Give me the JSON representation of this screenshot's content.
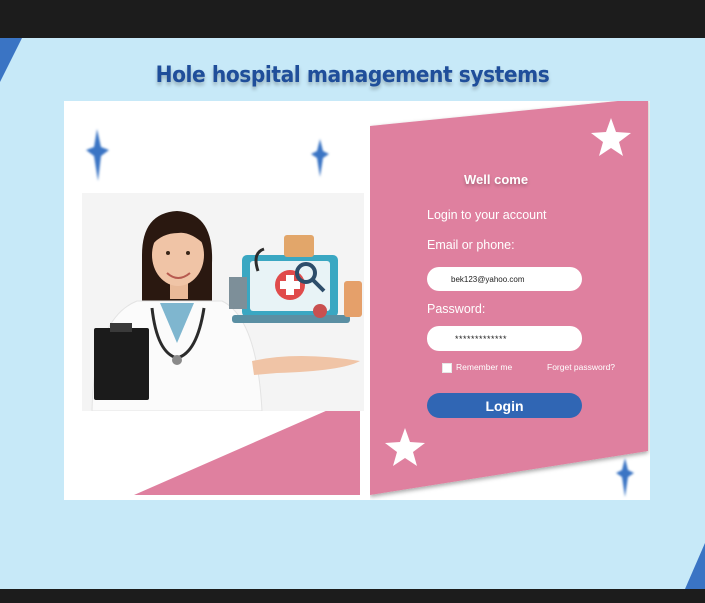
{
  "page": {
    "title": "Hole hospital management systems"
  },
  "login": {
    "welcome": "Well come",
    "subtitle": "Login to your account",
    "email_label": "Email or phone:",
    "email_value": "bek123@yahoo.com",
    "password_label": "Password:",
    "password_value": "*************",
    "remember_label": "Remember me",
    "forgot_label": "Forget password?",
    "login_label": "Login"
  },
  "colors": {
    "background": "#c7e9f8",
    "pink": "#df809f",
    "accent_blue": "#3066b4",
    "title_blue": "#1f4e9a"
  },
  "icons": [
    "star-icon",
    "doctor-illustration",
    "medical-kit-illustration"
  ]
}
